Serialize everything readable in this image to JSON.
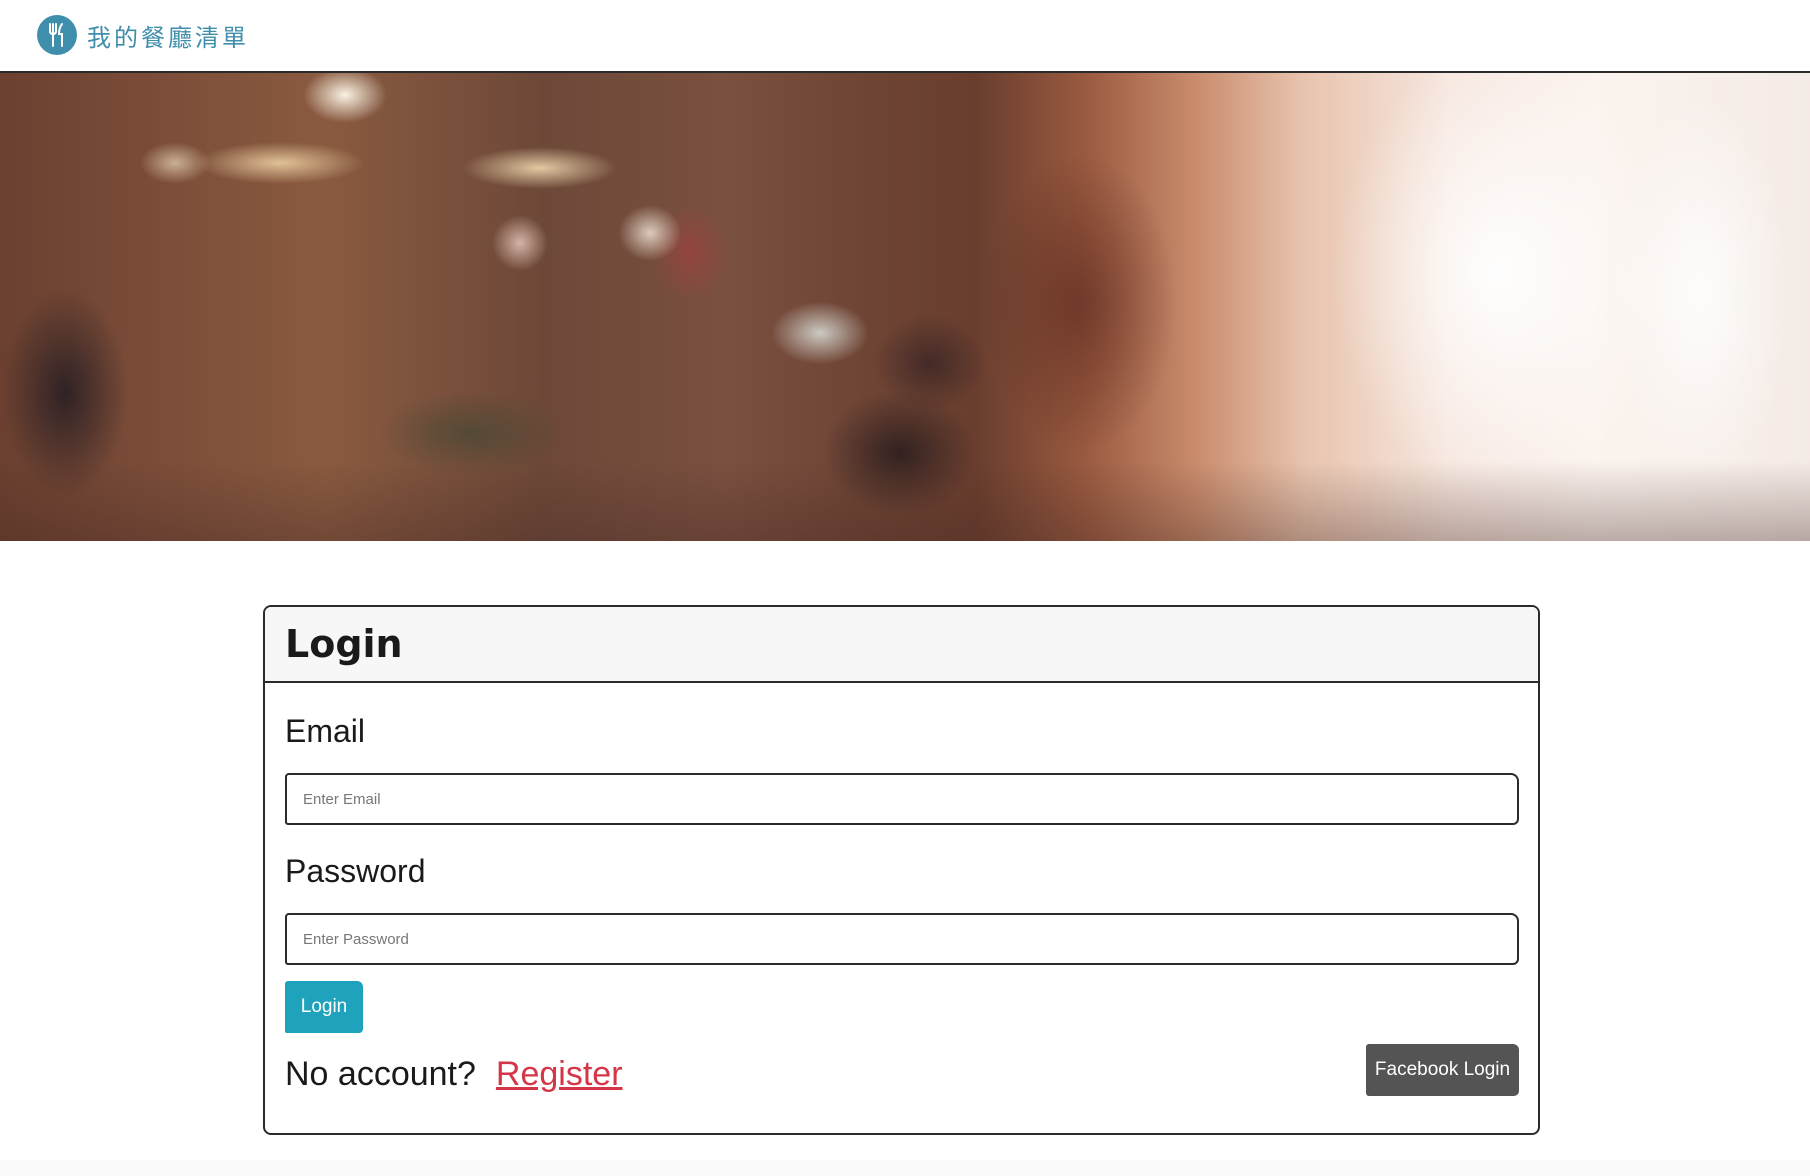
{
  "navbar": {
    "brand_title": "我的餐廳清單",
    "brand_icon": "utensils-icon",
    "brand_color": "#3f8eab"
  },
  "login": {
    "title": "Login",
    "email_label": "Email",
    "email_placeholder": "Enter Email",
    "password_label": "Password",
    "password_placeholder": "Enter Password",
    "login_button": "Login",
    "no_account_text": "No account?",
    "register_link": "Register",
    "facebook_button": "Facebook Login"
  },
  "colors": {
    "login_button": "#1fa2bb",
    "register_link": "#d63548",
    "facebook_button": "#545454"
  }
}
